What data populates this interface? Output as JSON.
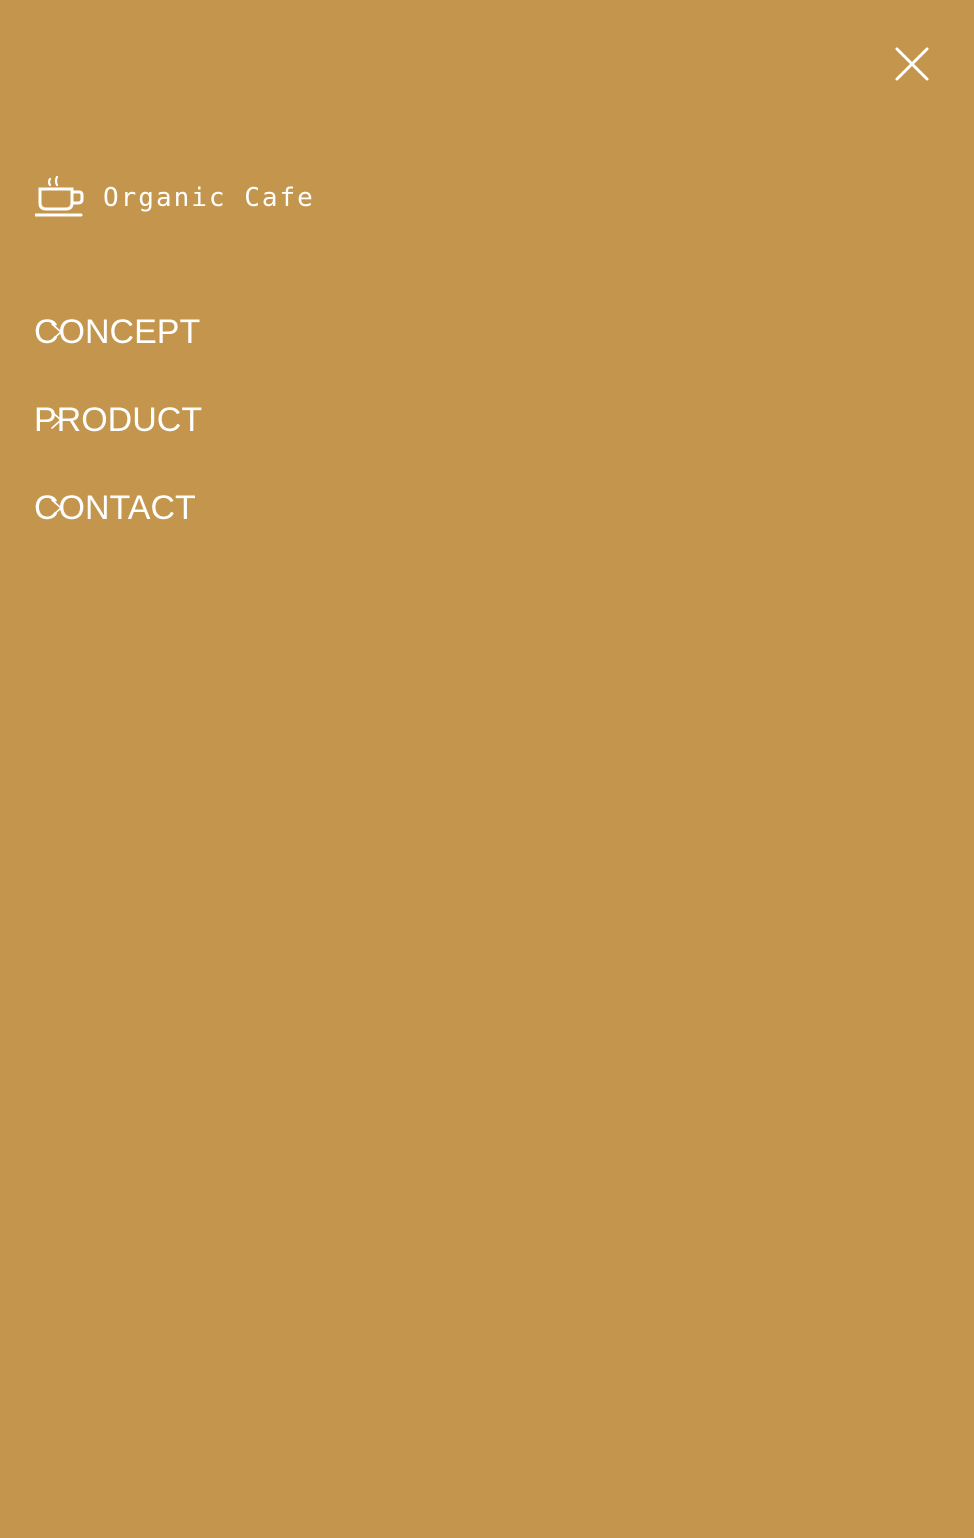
{
  "overlay": {
    "close_icon": "close-icon"
  },
  "brand": {
    "icon": "coffee-cup-icon",
    "name": "Organic Cafe"
  },
  "menu": {
    "items": [
      {
        "label": "CONCEPT",
        "icon": "chevron-right-icon"
      },
      {
        "label": "PRODUCT",
        "icon": "chevron-right-icon"
      },
      {
        "label": "CONTACT",
        "icon": "chevron-right-icon"
      }
    ]
  },
  "colors": {
    "background": "#c4964d",
    "foreground": "#ffffff"
  }
}
